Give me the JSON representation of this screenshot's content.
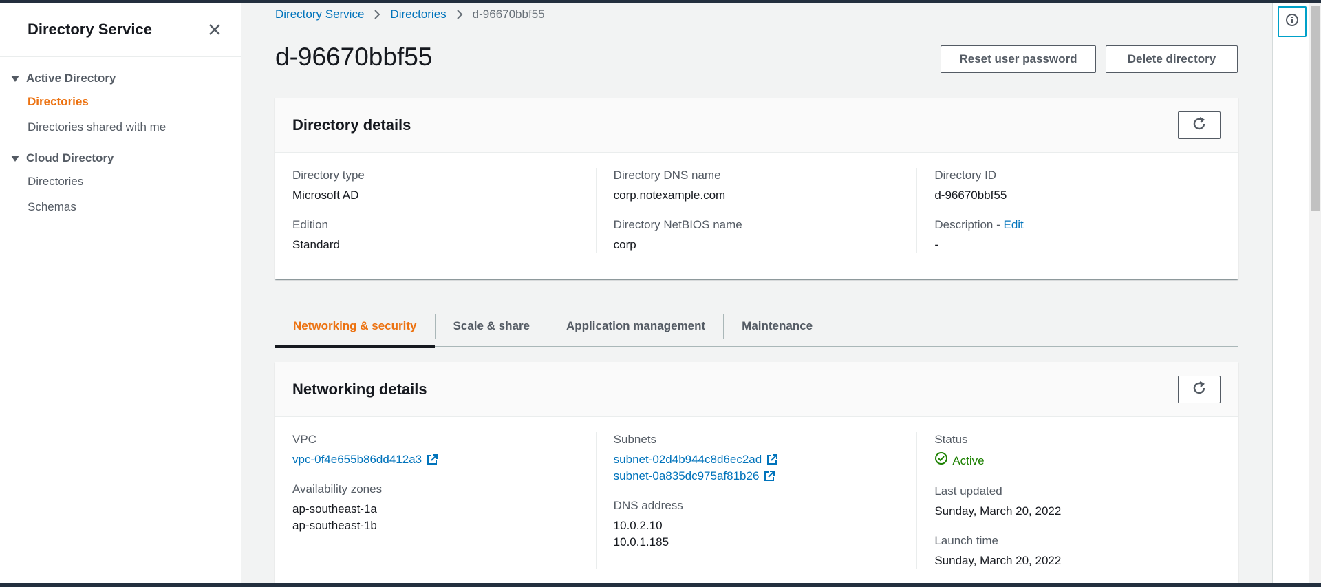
{
  "sidebar": {
    "title": "Directory Service",
    "sections": [
      {
        "label": "Active Directory",
        "items": [
          {
            "label": "Directories",
            "active": true
          },
          {
            "label": "Directories shared with me"
          }
        ]
      },
      {
        "label": "Cloud Directory",
        "items": [
          {
            "label": "Directories"
          },
          {
            "label": "Schemas"
          }
        ]
      }
    ]
  },
  "breadcrumb": {
    "items": [
      "Directory Service",
      "Directories"
    ],
    "current": "d-96670bbf55"
  },
  "page": {
    "title": "d-96670bbf55",
    "reset_label": "Reset user password",
    "delete_label": "Delete directory"
  },
  "directory_details": {
    "title": "Directory details",
    "type_label": "Directory type",
    "type_value": "Microsoft AD",
    "edition_label": "Edition",
    "edition_value": "Standard",
    "dns_label": "Directory DNS name",
    "dns_value": "corp.notexample.com",
    "netbios_label": "Directory NetBIOS name",
    "netbios_value": "corp",
    "id_label": "Directory ID",
    "id_value": "d-96670bbf55",
    "desc_label": "Description - ",
    "desc_edit": "Edit",
    "desc_value": "-"
  },
  "tabs": [
    "Networking & security",
    "Scale & share",
    "Application management",
    "Maintenance"
  ],
  "networking": {
    "title": "Networking details",
    "vpc_label": "VPC",
    "vpc_value": "vpc-0f4e655b86dd412a3",
    "az_label": "Availability zones",
    "az_values": [
      "ap-southeast-1a",
      "ap-southeast-1b"
    ],
    "subnets_label": "Subnets",
    "subnets": [
      "subnet-02d4b944c8d6ec2ad",
      "subnet-0a835dc975af81b26"
    ],
    "dns_label": "DNS address",
    "dns_values": [
      "10.0.2.10",
      "10.0.1.185"
    ],
    "status_label": "Status",
    "status_value": "Active",
    "updated_label": "Last updated",
    "updated_value": "Sunday, March 20, 2022",
    "launch_label": "Launch time",
    "launch_value": "Sunday, March 20, 2022"
  },
  "colors": {
    "accent": "#ec7211",
    "link": "#0073bb",
    "success": "#1d8102"
  },
  "icons": [
    "close-icon",
    "caret-down-icon",
    "chevron-right-icon",
    "refresh-icon",
    "external-link-icon",
    "status-positive-icon",
    "info-icon"
  ]
}
